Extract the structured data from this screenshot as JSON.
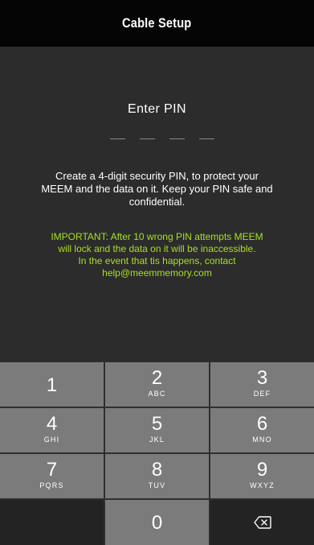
{
  "header": {
    "title": "Cable Setup"
  },
  "pin": {
    "title": "Enter PIN",
    "slot_count": 4
  },
  "instructions": {
    "line1": "Create a 4-digit security PIN, to protect your",
    "line2": "MEEM and the data on it. Keep your PIN safe and",
    "line3": "confidential."
  },
  "warning": {
    "line1": "IMPORTANT: After 10 wrong PIN attempts MEEM",
    "line2": "will lock and the data on it will be inaccessible.",
    "line3": "In the event that tis happens, contact",
    "line4": "help@meemmemory.com"
  },
  "keypad": {
    "keys": [
      {
        "digit": "1",
        "letters": ""
      },
      {
        "digit": "2",
        "letters": "ABC"
      },
      {
        "digit": "3",
        "letters": "DEF"
      },
      {
        "digit": "4",
        "letters": "GHI"
      },
      {
        "digit": "5",
        "letters": "JKL"
      },
      {
        "digit": "6",
        "letters": "MNO"
      },
      {
        "digit": "7",
        "letters": "PQRS"
      },
      {
        "digit": "8",
        "letters": "TUV"
      },
      {
        "digit": "9",
        "letters": "WXYZ"
      },
      {
        "digit": "0",
        "letters": ""
      }
    ],
    "delete_icon": "backspace-icon"
  },
  "colors": {
    "header_bg": "#050505",
    "main_bg": "#2c2c2c",
    "key_bg": "#7b7b7b",
    "warning_text": "#a6e01f"
  }
}
